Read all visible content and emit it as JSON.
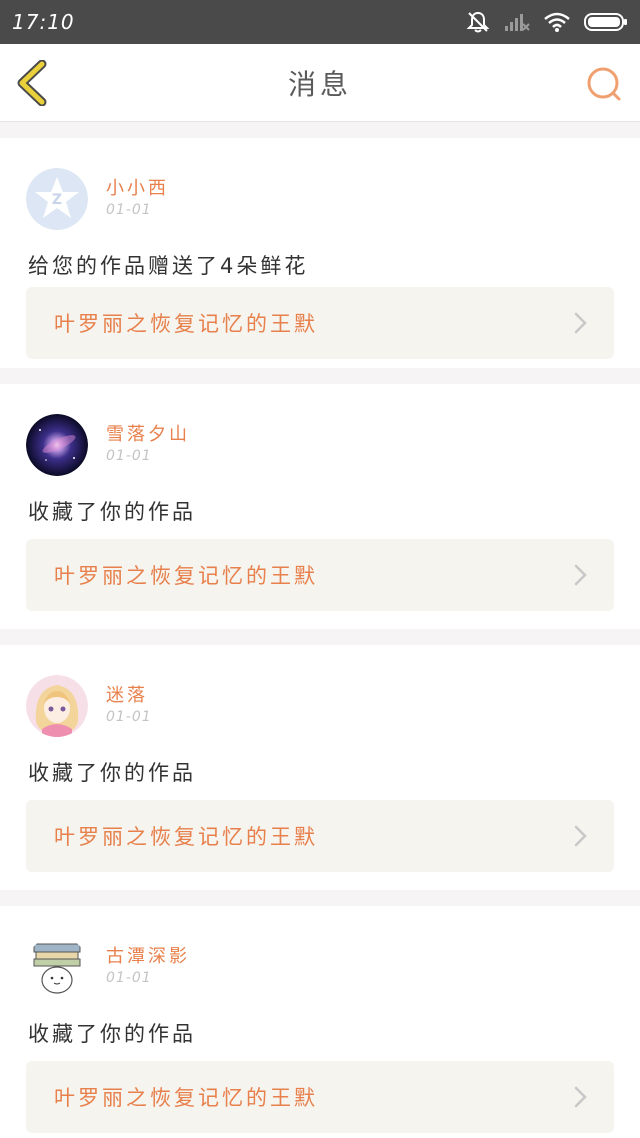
{
  "status": {
    "time": "17:10",
    "icons": [
      "mute-icon",
      "signal-icon",
      "wifi-icon",
      "battery-icon"
    ]
  },
  "nav": {
    "title": "消息",
    "back_icon": "back-chevron-icon",
    "search_icon": "search-icon"
  },
  "colors": {
    "accent": "#e8804c",
    "back_icon": "#ead03a",
    "search_icon": "#f0a070"
  },
  "messages": [
    {
      "username": "小小西",
      "date": "01-01",
      "text": "给您的作品赠送了4朵鲜花",
      "work_title": "叶罗丽之恢复记忆的王默",
      "avatar": "qq-default-avatar"
    },
    {
      "username": "雪落夕山",
      "date": "01-01",
      "text": "收藏了你的作品",
      "work_title": "叶罗丽之恢复记忆的王默",
      "avatar": "galaxy-avatar"
    },
    {
      "username": "迷落",
      "date": "01-01",
      "text": "收藏了你的作品",
      "work_title": "叶罗丽之恢复记忆的王默",
      "avatar": "anime-girl-avatar"
    },
    {
      "username": "古潭深影",
      "date": "01-01",
      "text": "收藏了你的作品",
      "work_title": "叶罗丽之恢复记忆的王默",
      "avatar": "book-character-avatar"
    }
  ]
}
